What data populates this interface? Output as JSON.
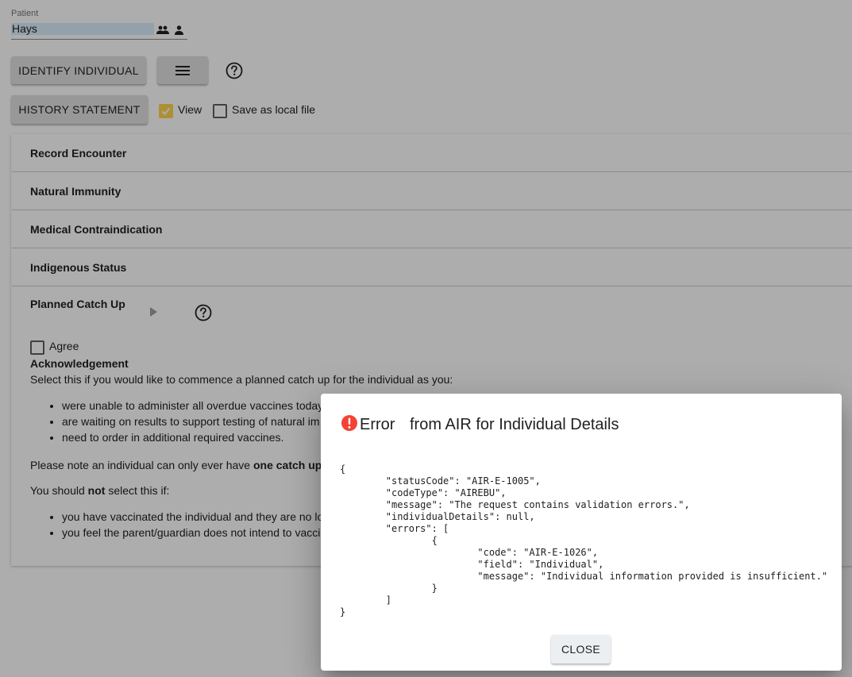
{
  "patient": {
    "label": "Patient",
    "value": "Hays",
    "icons": [
      "group-icon",
      "person-icon"
    ]
  },
  "toolbar": {
    "identify_label": "IDENTIFY INDIVIDUAL",
    "menu_icon": "menu-icon",
    "help_icon": "help-icon"
  },
  "history": {
    "button_label": "HISTORY STATEMENT",
    "view": {
      "label": "View",
      "checked": true
    },
    "save_local": {
      "label": "Save as local file",
      "checked": false
    }
  },
  "panels": [
    {
      "title": "Record Encounter"
    },
    {
      "title": "Natural Immunity"
    },
    {
      "title": "Medical Contraindication"
    },
    {
      "title": "Indigenous Status"
    },
    {
      "title": "Planned Catch Up"
    }
  ],
  "catchup": {
    "play_icon": "play-icon",
    "help_icon": "help-icon",
    "agree_label": "Agree",
    "ack_heading": "Acknowledgement",
    "intro": "Select this if you would like to commence a planned catch up for the individual as you:",
    "reasons": [
      "were unable to administer all overdue vaccines today",
      "are waiting on results to support testing of natural im",
      "need to order in additional required vaccines."
    ],
    "note_prefix": "Please note an individual can only ever have ",
    "note_bold": "one catch up s",
    "not_prefix": "You should ",
    "not_bold": "not",
    "not_suffix": " select this if:",
    "not_reasons": [
      "you have vaccinated the individual and they are no lo",
      "you feel the parent/guardian does not intend to vacci"
    ]
  },
  "dialog": {
    "icon": "error-icon",
    "title_error": "Error",
    "title_rest": "from AIR for Individual Details",
    "json_text": "{\n\t\"statusCode\": \"AIR-E-1005\",\n\t\"codeType\": \"AIREBU\",\n\t\"message\": \"The request contains validation errors.\",\n\t\"individualDetails\": null,\n\t\"errors\": [\n\t\t{\n\t\t\t\"code\": \"AIR-E-1026\",\n\t\t\t\"field\": \"Individual\",\n\t\t\t\"message\": \"Individual information provided is insufficient.\"\n\t\t}\n\t]\n}",
    "close_label": "CLOSE"
  },
  "colors": {
    "checkbox_checked": "#ffd54f",
    "error_icon": "#f44336",
    "dialog_button": "#eceff1"
  }
}
